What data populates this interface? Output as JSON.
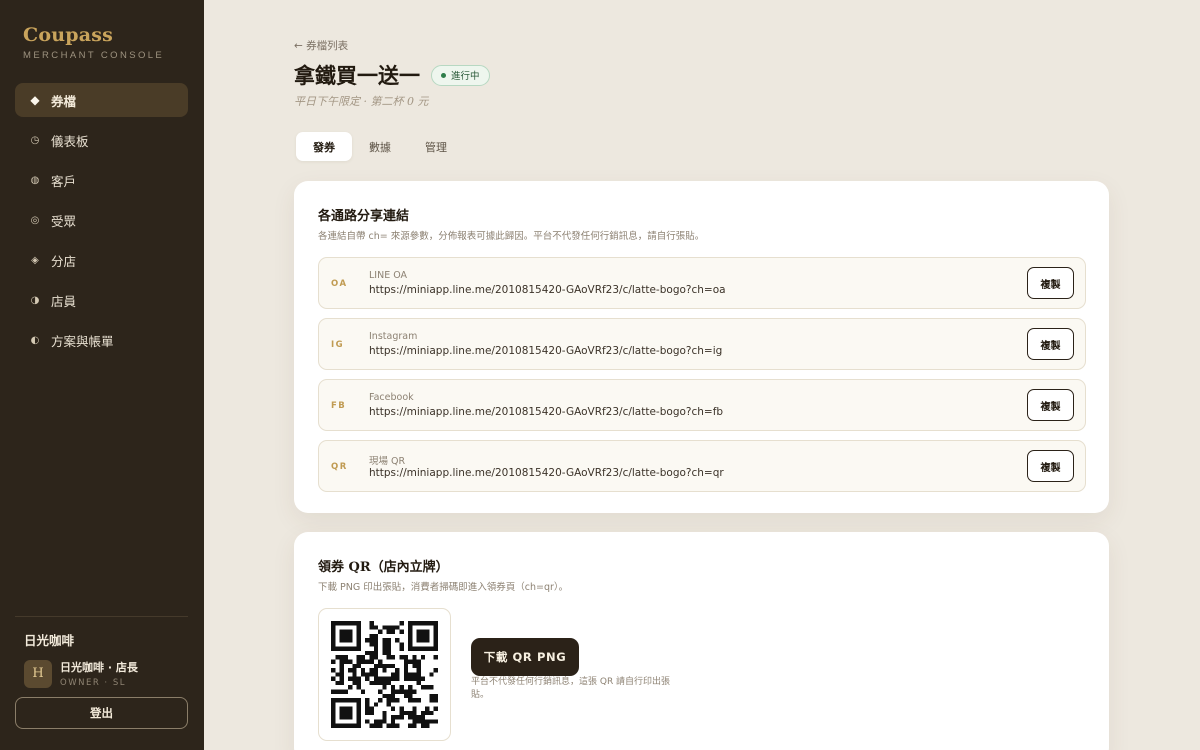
{
  "brand": {
    "name": "Coupass",
    "subtitle": "MERCHANT CONSOLE"
  },
  "sidebar": {
    "items": [
      {
        "label": "券檔",
        "icon": "diamond-icon",
        "active": true
      },
      {
        "label": "儀表板",
        "icon": "clock-icon"
      },
      {
        "label": "客戶",
        "icon": "dot-circle-icon"
      },
      {
        "label": "受眾",
        "icon": "target-icon"
      },
      {
        "label": "分店",
        "icon": "small-diamond-icon"
      },
      {
        "label": "店員",
        "icon": "half-circle-icon"
      },
      {
        "label": "方案與帳單",
        "icon": "half-moon-icon"
      }
    ],
    "shop_name": "日光咖啡",
    "user": {
      "avatar_letter": "H",
      "name": "日光咖啡 · 店長",
      "role": "OWNER · SL"
    },
    "logout_label": "登出"
  },
  "header": {
    "back_label": "← 券檔列表",
    "title": "拿鐵買一送一",
    "status": "進行中",
    "subtitle": "平日下午限定 · 第二杯 0 元"
  },
  "tabs": [
    {
      "label": "發券",
      "active": true
    },
    {
      "label": "數據"
    },
    {
      "label": "管理"
    }
  ],
  "links_card": {
    "title": "各通路分享連結",
    "description": "各連結自帶 ch= 來源參數，分佈報表可據此歸因。平台不代發任何行銷訊息，請自行張貼。",
    "copy_label": "複製",
    "rows": [
      {
        "code": "OA",
        "channel": "LINE OA",
        "url": "https://miniapp.line.me/2010815420-GAoVRf23/c/latte-bogo?ch=oa"
      },
      {
        "code": "IG",
        "channel": "Instagram",
        "url": "https://miniapp.line.me/2010815420-GAoVRf23/c/latte-bogo?ch=ig"
      },
      {
        "code": "FB",
        "channel": "Facebook",
        "url": "https://miniapp.line.me/2010815420-GAoVRf23/c/latte-bogo?ch=fb"
      },
      {
        "code": "QR",
        "channel": "現場 QR",
        "url": "https://miniapp.line.me/2010815420-GAoVRf23/c/latte-bogo?ch=qr"
      }
    ]
  },
  "qr_card": {
    "title": "領券 QR（店內立牌）",
    "description": "下載 PNG 印出張貼，消費者掃碼即進入領券頁（ch=qr）。",
    "download_label": "下載 QR PNG",
    "note": "平台不代發任何行銷訊息，這張 QR 請自行印出張貼。"
  },
  "colors": {
    "sidebar_bg": "#2d251b",
    "accent_gold": "#c9a45c",
    "page_bg": "#ede8df",
    "status_green": "#2e7d4a"
  }
}
